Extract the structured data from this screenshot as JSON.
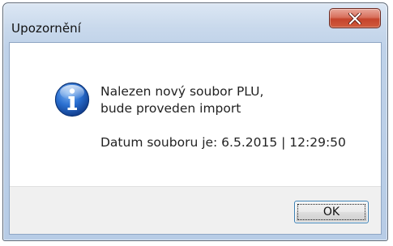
{
  "dialog": {
    "title": "Upozornění",
    "icon": "information-icon",
    "message_lines": [
      "Nalezen nový soubor PLU,",
      "bude proveden import"
    ],
    "date_text": "Datum souboru je: 6.5.2015 | 12:29:50",
    "ok_label": "OK",
    "close_icon": "close-x-icon",
    "colors": {
      "close_button": "#c5442c",
      "info_icon": "#1f5fbf",
      "frame": "#bfd2e9",
      "focus_border": "#3c7fb1"
    }
  }
}
